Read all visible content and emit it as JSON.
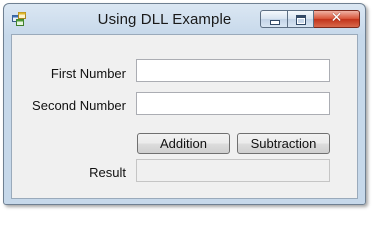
{
  "window": {
    "title": "Using DLL Example",
    "app_icon": "windows-form-icon",
    "controls": {
      "minimize_icon": "minimize-icon",
      "maximize_icon": "maximize-icon",
      "close_icon": "close-icon",
      "close_glyph": "✕"
    }
  },
  "form": {
    "first_number": {
      "label": "First Number",
      "value": ""
    },
    "second_number": {
      "label": "Second Number",
      "value": ""
    },
    "buttons": {
      "addition": "Addition",
      "subtraction": "Subtraction"
    },
    "result": {
      "label": "Result",
      "value": ""
    }
  },
  "colors": {
    "title_bar": "#c6d8ea",
    "client_bg": "#f0f0f0",
    "close_button": "#c2331a"
  }
}
